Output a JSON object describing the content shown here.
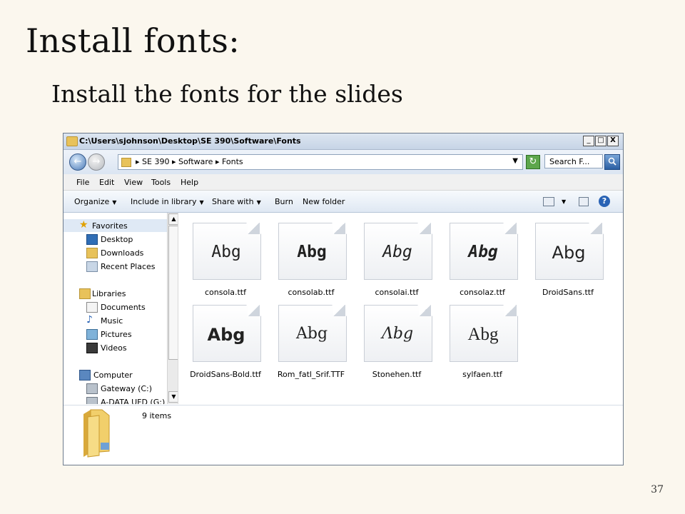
{
  "slide": {
    "title": "Install fonts:",
    "subtitle": "Install the fonts for the slides",
    "page_number": "37"
  },
  "window": {
    "title": "C:\\Users\\sjohnson\\Desktop\\SE 390\\Software\\Fonts",
    "controls": [
      "_",
      "□",
      "X"
    ]
  },
  "address": {
    "crumbs": "▸  SE 390  ▸  Software  ▸  Fonts",
    "search_placeholder": "Search F..."
  },
  "menu": {
    "items": [
      "File",
      "Edit",
      "View",
      "Tools",
      "Help"
    ]
  },
  "toolbar": {
    "organize": "Organize",
    "include_in_library": "Include in library",
    "share_with": "Share with",
    "burn": "Burn",
    "new_folder": "New folder"
  },
  "nav": {
    "items": [
      {
        "label": "Favorites",
        "icon": "star-icon"
      },
      {
        "label": "Desktop",
        "icon": "desktop-icon"
      },
      {
        "label": "Downloads",
        "icon": "downloads-icon"
      },
      {
        "label": "Recent Places",
        "icon": "recent-places-icon"
      },
      {
        "label": "Libraries",
        "icon": "libraries-icon"
      },
      {
        "label": "Documents",
        "icon": "documents-icon"
      },
      {
        "label": "Music",
        "icon": "music-icon"
      },
      {
        "label": "Pictures",
        "icon": "pictures-icon"
      },
      {
        "label": "Videos",
        "icon": "videos-icon"
      },
      {
        "label": "Computer",
        "icon": "computer-icon"
      },
      {
        "label": "Gateway (C:)",
        "icon": "drive-icon"
      },
      {
        "label": "A-DATA UFD (G:)",
        "icon": "usb-drive-icon"
      }
    ]
  },
  "files": [
    {
      "name": "consola.ttf",
      "sample": "Abg"
    },
    {
      "name": "consolab.ttf",
      "sample": "Abg"
    },
    {
      "name": "consolai.ttf",
      "sample": "Abg"
    },
    {
      "name": "consolaz.ttf",
      "sample": "Abg"
    },
    {
      "name": "DroidSans.ttf",
      "sample": "Abg"
    },
    {
      "name": "DroidSans-Bold.ttf",
      "sample": "Abg"
    },
    {
      "name": "Rom_fatl_Srif.TTF",
      "sample": "Abg"
    },
    {
      "name": "Stonehen.ttf",
      "sample": "Λbg"
    },
    {
      "name": "sylfaen.ttf",
      "sample": "Abg"
    }
  ],
  "details": {
    "count": "9 items"
  },
  "colors": {
    "slide_background": "#fbf7ee",
    "folder_yellow": "#e8c25a",
    "selection_blue": "#dfe9f5"
  }
}
